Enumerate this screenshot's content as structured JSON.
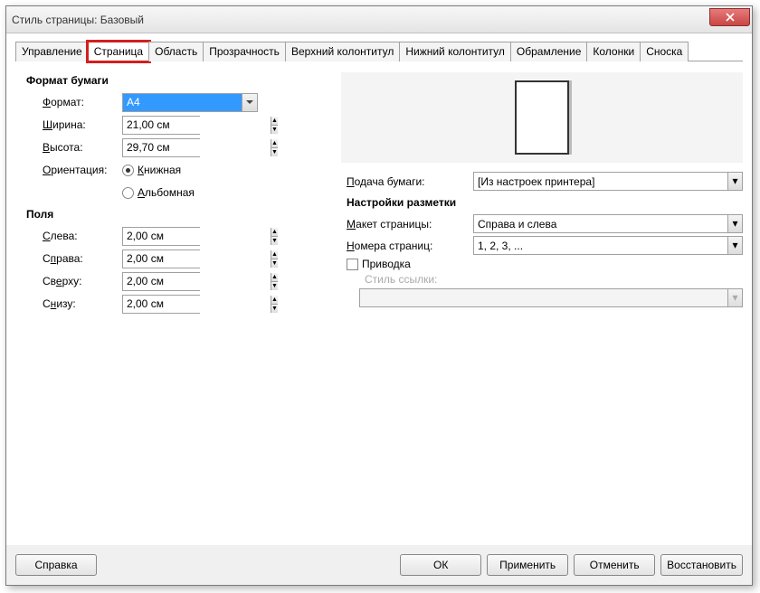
{
  "title": "Стиль страницы: Базовый",
  "tabs": [
    "Управление",
    "Страница",
    "Область",
    "Прозрачность",
    "Верхний колонтитул",
    "Нижний колонтитул",
    "Обрамление",
    "Колонки",
    "Сноска"
  ],
  "paper": {
    "section": "Формат бумаги",
    "format_label": "Формат:",
    "format_value": "A4",
    "width_label": "Ширина:",
    "width_value": "21,00 см",
    "height_label": "Высота:",
    "height_value": "29,70 см",
    "orient_label": "Ориентация:",
    "orient_portrait": "Книжная",
    "orient_landscape": "Альбомная",
    "tray_label": "Подача бумаги:",
    "tray_value": "[Из настроек принтера]"
  },
  "margins": {
    "section": "Поля",
    "left_label": "Слева:",
    "left_value": "2,00 см",
    "right_label": "Справа:",
    "right_value": "2,00 см",
    "top_label": "Сверху:",
    "top_value": "2,00 см",
    "bottom_label": "Снизу:",
    "bottom_value": "2,00 см"
  },
  "layout": {
    "section": "Настройки разметки",
    "pagelayout_label": "Макет страницы:",
    "pagelayout_value": "Справа и слева",
    "pagenum_label": "Номера страниц:",
    "pagenum_value": "1, 2, 3, ...",
    "register_label": "Приводка",
    "refstyle_label": "Стиль ссылки:"
  },
  "buttons": {
    "help": "Справка",
    "ok": "ОК",
    "apply": "Применить",
    "cancel": "Отменить",
    "reset": "Восстановить"
  }
}
